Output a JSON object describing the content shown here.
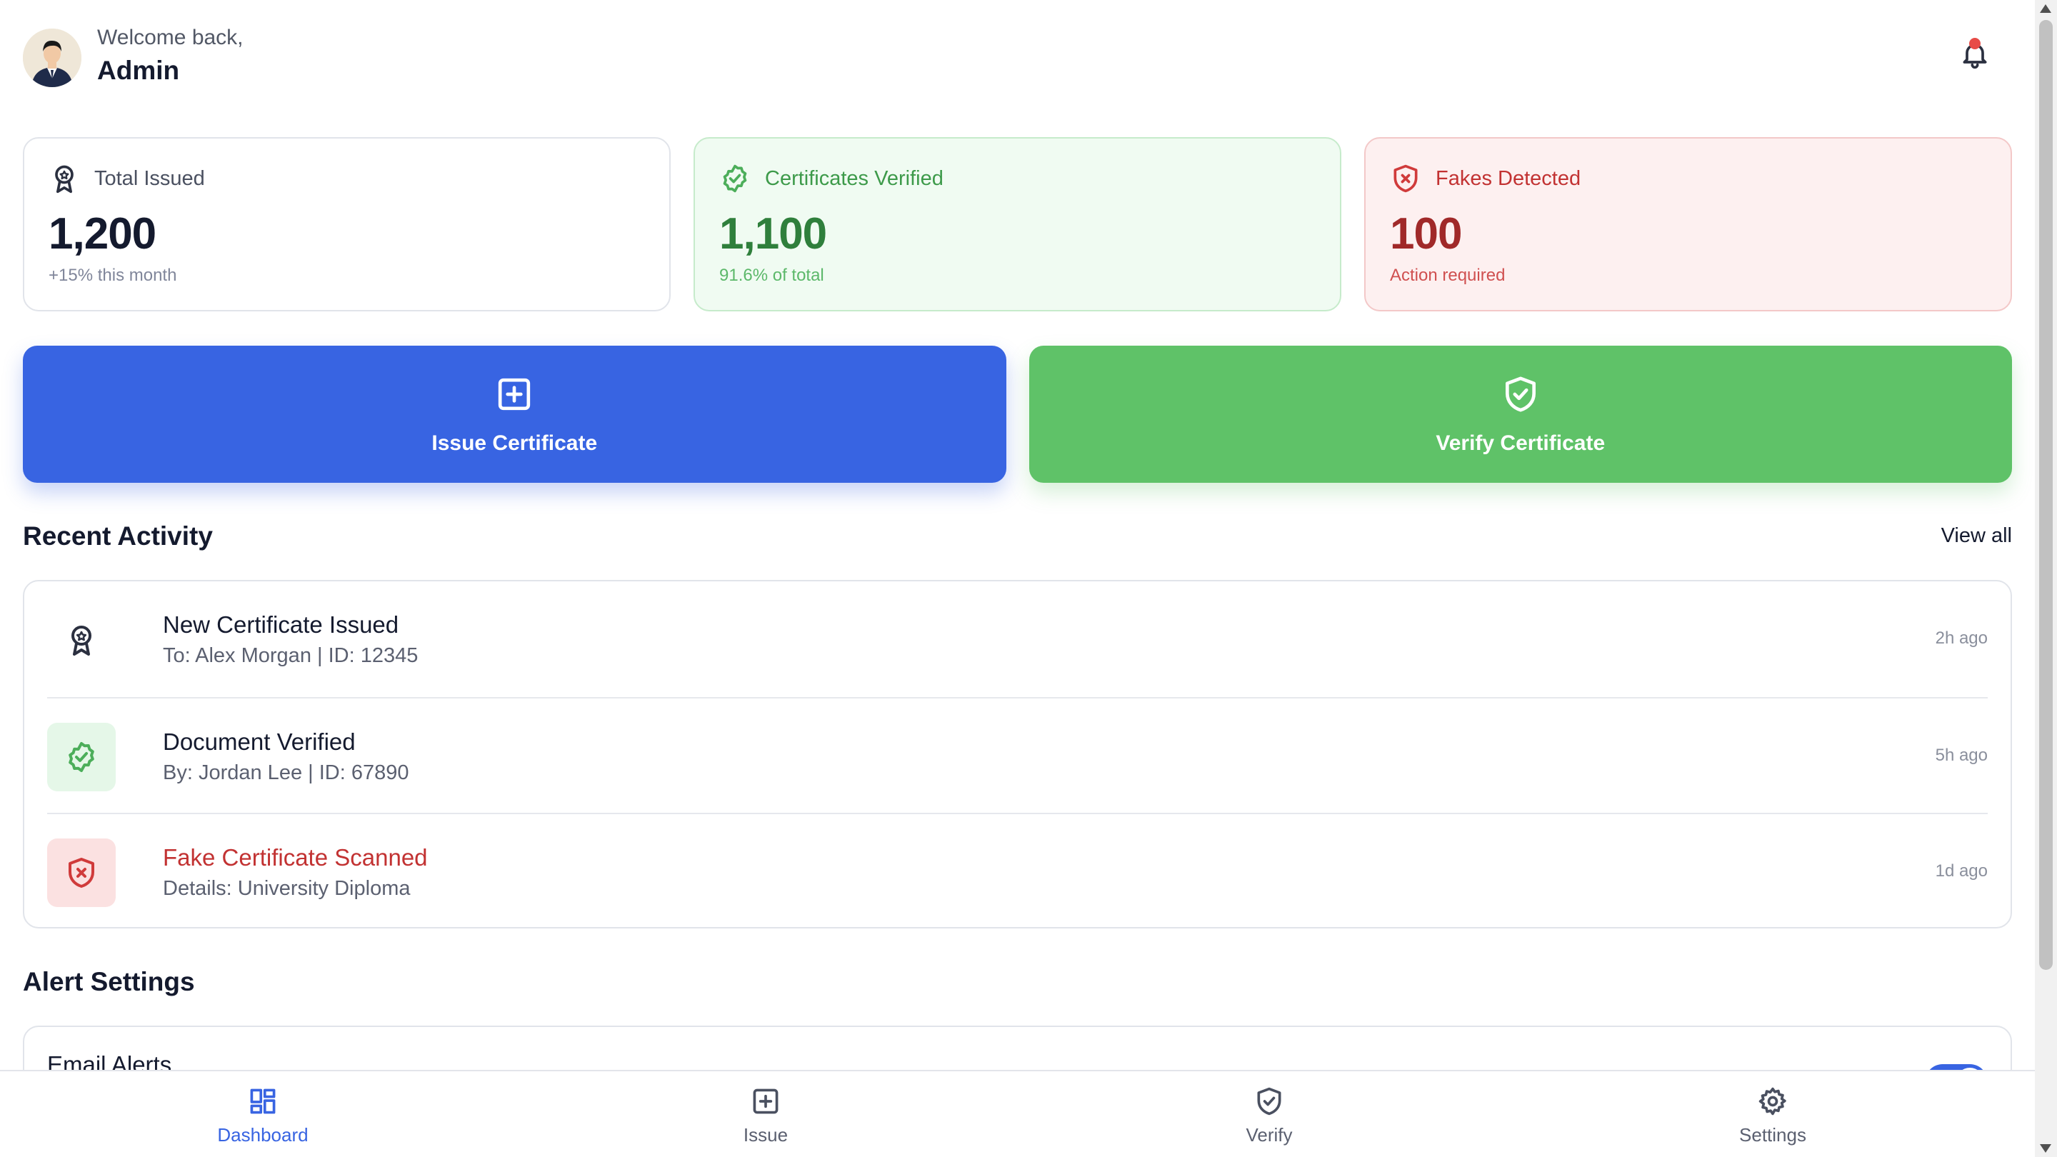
{
  "header": {
    "welcome_text": "Welcome back,",
    "user_name": "Admin",
    "has_unread_notifications": true
  },
  "stats": [
    {
      "icon": "award-icon",
      "label": "Total Issued",
      "value": "1,200",
      "sub": "+15% this month",
      "tone": "neutral"
    },
    {
      "icon": "badge-check-icon",
      "label": "Certificates Verified",
      "value": "1,100",
      "sub": "91.6% of total",
      "tone": "green"
    },
    {
      "icon": "shield-x-icon",
      "label": "Fakes Detected",
      "value": "100",
      "sub": "Action required",
      "tone": "red"
    }
  ],
  "actions": {
    "issue_label": "Issue Certificate",
    "verify_label": "Verify Certificate"
  },
  "recent_activity": {
    "title": "Recent Activity",
    "view_all": "View all",
    "items": [
      {
        "icon": "award-icon",
        "title": "New Certificate Issued",
        "detail": "To: Alex Morgan | ID: 12345",
        "time": "2h ago"
      },
      {
        "icon": "badge-check-icon",
        "title": "Document Verified",
        "detail": "By: Jordan Lee | ID: 67890",
        "time": "5h ago"
      },
      {
        "icon": "shield-x-icon",
        "title": "Fake Certificate Scanned",
        "detail": "Details: University Diploma",
        "time": "1d ago"
      }
    ]
  },
  "alert_settings": {
    "title": "Alert Settings",
    "items": [
      {
        "label": "Email Alerts",
        "enabled": true
      }
    ]
  },
  "bottom_nav": [
    {
      "icon": "dashboard-icon",
      "label": "Dashboard",
      "active": true
    },
    {
      "icon": "plus-square-icon",
      "label": "Issue",
      "active": false
    },
    {
      "icon": "shield-check-icon",
      "label": "Verify",
      "active": false
    },
    {
      "icon": "gear-icon",
      "label": "Settings",
      "active": false
    }
  ],
  "colors": {
    "primary": "#3864e2",
    "success": "#5fc268",
    "danger": "#c23232",
    "text": "#141a2e"
  }
}
